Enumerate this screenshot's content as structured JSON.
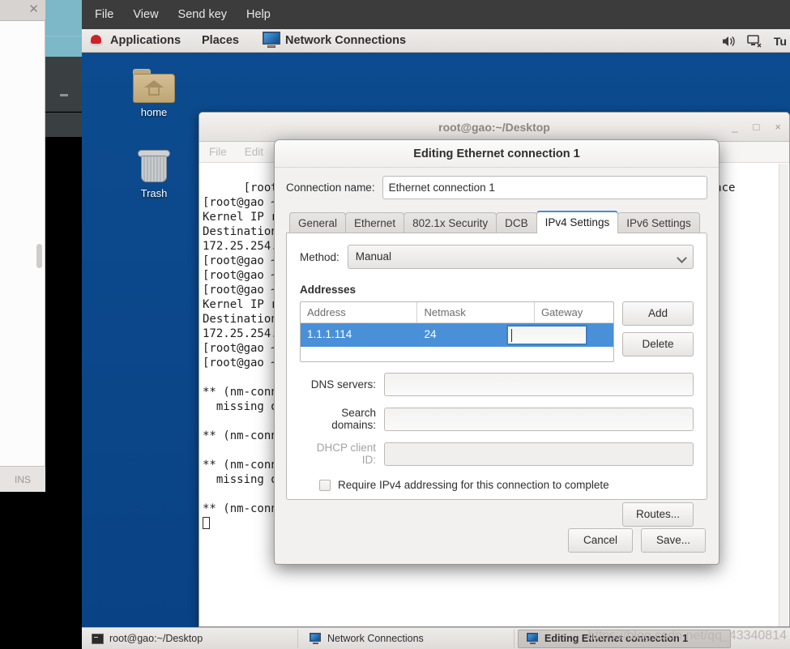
{
  "vm_menu": {
    "items": [
      "File",
      "View",
      "Send key",
      "Help"
    ]
  },
  "panel": {
    "applications_label": "Applications",
    "places_label": "Places",
    "window_label": "Network Connections",
    "tray": {
      "volume_icon": "speaker-icon",
      "network_icon": "network-icon",
      "clock": "Tu"
    }
  },
  "desktop": {
    "icons": [
      {
        "name": "home",
        "icon": "folder-home-icon"
      },
      {
        "name": "Trash",
        "icon": "trash-icon"
      }
    ]
  },
  "terminal": {
    "title": "root@gao:~/Desktop",
    "menu": [
      "File",
      "Edit",
      "View"
    ],
    "window_buttons": {
      "minimize": "_",
      "maximize": "□",
      "close": "×"
    },
    "lines": [
      "[root@gao ~]# route -n                                             Iface",
      "[root@gao ~]# route -n                                             eth0",
      "Kernel IP routing table",
      "Destination     Gateway         Genmask         Flags Metric Ref",
      "172.25.254.0    0.0.0.0         255.255.255.0   U     0      0",
      "[root@gao ~]# ",
      "[root@gao ~]# route -n",
      "[root@gao ~]# route -n                                             Iface",
      "Kernel IP routing table                                            eth0",
      "Destination     Gateway         Genmask         Flags Metric Ref",
      "172.25.254.0    0.0.0.0         255.255.255.0   U     0      0",
      "[root@gao ~]# ",
      "[root@gao ~]# nm-connection-editor",
      "",
      "** (nm-connection-editor:2847): WARNING **: Connection      '<none>'",
      "  missing or invalid property",
      "",
      "** (nm-connection-editor:2847): WARNING **: Invalid settings",
      "",
      "** (nm-connection-editor:2847): WARNING **: Connection      '<none>'",
      "  missing or invalid property",
      "",
      "** (nm-connection-editor:2847): WARNING **: Invalid settings"
    ]
  },
  "dialog": {
    "title": "Editing Ethernet connection 1",
    "connection_name_label": "Connection name:",
    "connection_name_value": "Ethernet connection 1",
    "tabs": [
      {
        "label": "General",
        "active": false
      },
      {
        "label": "Ethernet",
        "active": false
      },
      {
        "label": "802.1x Security",
        "active": false
      },
      {
        "label": "DCB",
        "active": false
      },
      {
        "label": "IPv4 Settings",
        "active": true
      },
      {
        "label": "IPv6 Settings",
        "active": false
      }
    ],
    "method_label": "Method:",
    "method_value": "Manual",
    "addresses_title": "Addresses",
    "addr_columns": [
      "Address",
      "Netmask",
      "Gateway"
    ],
    "addr_rows": [
      {
        "address": "1.1.1.114",
        "netmask": "24",
        "gateway": ""
      }
    ],
    "add_label": "Add",
    "delete_label": "Delete",
    "dns_label": "DNS servers:",
    "dns_value": "",
    "search_label": "Search domains:",
    "search_value": "",
    "dhcp_label": "DHCP client ID:",
    "dhcp_value": "",
    "require_ipv4_label": "Require IPv4 addressing for this connection to complete",
    "require_ipv4_checked": false,
    "routes_label": "Routes...",
    "cancel_label": "Cancel",
    "save_label": "Save...",
    "accent_color": "#4a90d9"
  },
  "left_window": {
    "close_icon": "close-icon",
    "status": "INS"
  },
  "taskbar": {
    "items": [
      {
        "label": "root@gao:~/Desktop",
        "icon": "terminal-icon",
        "active": false
      },
      {
        "label": "Network Connections",
        "icon": "network-icon",
        "active": false
      },
      {
        "label": "Editing Ethernet connection 1",
        "icon": "network-icon",
        "active": true
      }
    ],
    "watermark": "https://blog.csdn.net/qq_43340814"
  }
}
